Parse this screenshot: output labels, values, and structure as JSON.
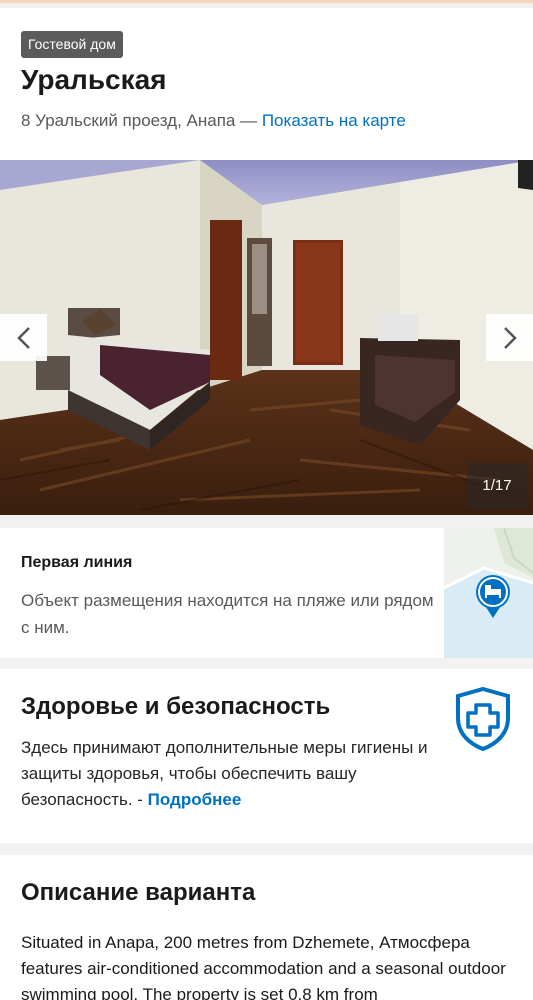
{
  "header": {
    "badge": "Гостевой дом",
    "title": "Уральская",
    "address": "8 Уральский проезд, Анапа — ",
    "map_link": "Показать на карте"
  },
  "gallery": {
    "counter": "1/17",
    "prev_icon": "chevron-left-icon",
    "next_icon": "chevron-right-icon"
  },
  "beach": {
    "title": "Первая линия",
    "text": "Объект размещения находится на пляже или рядом с ним.",
    "map_icon": "bed-pin-icon"
  },
  "health": {
    "title": "Здоровье и безопасность",
    "text": "Здесь принимают дополнительные меры гигиены и защиты здоровья, чтобы обеспечить вашу безопасность. - ",
    "more_link": "Подробнее",
    "icon": "shield-plus-icon"
  },
  "description": {
    "title": "Описание варианта",
    "text": "Situated in Anapa, 200 metres from Dzhemete, Атмосфера features air-conditioned accommodation and a seasonal outdoor swimming pool. The property is set 0.8 km from"
  },
  "colors": {
    "link": "#0071c2",
    "badge_bg": "#5b5b5b",
    "shield": "#0071c2",
    "pin": "#0071c2"
  }
}
